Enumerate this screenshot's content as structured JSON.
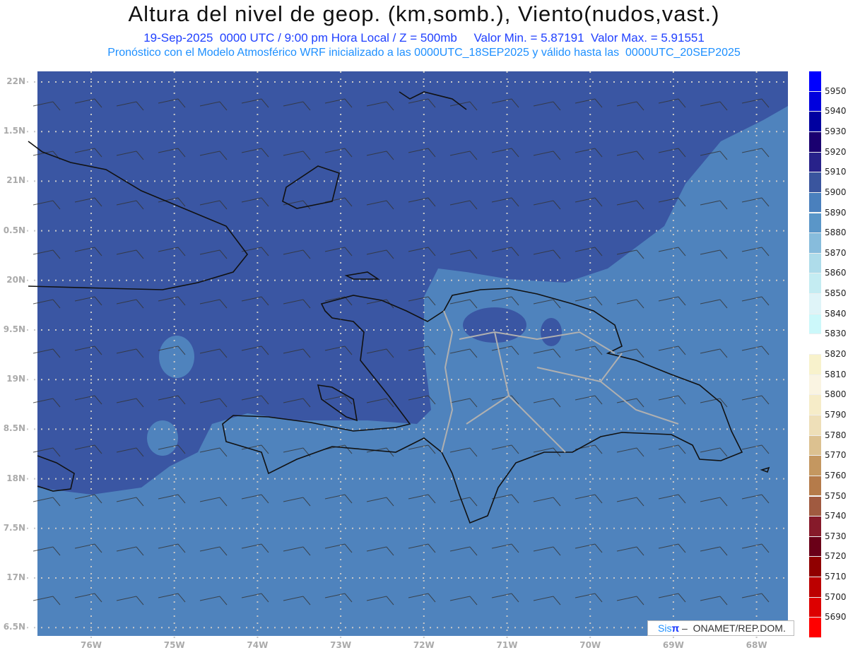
{
  "header": {
    "title": "Altura del nivel de geop. (km,somb.), Viento(nudos,vast.)",
    "subtitle": "19-Sep-2025  0000 UTC / 9:00 pm Hora Local / Z = 500mb     Valor Min. = 5.87191  Valor Max. = 5.91551",
    "model_line": "Pronóstico con el Modelo Atmosférico WRF inicializado a las 0000UTC_18SEP2025 y válido hasta las  0000UTC_20SEP2025"
  },
  "axes": {
    "lat_labels": [
      "22N",
      "1.5N",
      "21N",
      "0.5N",
      "20N",
      "9.5N",
      "19N",
      "8.5N",
      "18N",
      "7.5N",
      "17N",
      "6.5N"
    ],
    "lon_labels": [
      "76W",
      "75W",
      "74W",
      "73W",
      "72W",
      "71W",
      "70W",
      "69W",
      "68W"
    ]
  },
  "colorbar": {
    "labels": [
      "5950",
      "5940",
      "5930",
      "5920",
      "5910",
      "5900",
      "5890",
      "5880",
      "5870",
      "5860",
      "5850",
      "5840",
      "5830",
      "5820",
      "5810",
      "5800",
      "5790",
      "5780",
      "5770",
      "5760",
      "5750",
      "5740",
      "5730",
      "5720",
      "5710",
      "5700",
      "5690"
    ],
    "colors": [
      "#0000ff",
      "#0000dd",
      "#0000a0",
      "#1a0070",
      "#28228a",
      "#3a559e",
      "#4a80bd",
      "#5a96c8",
      "#87bcdc",
      "#aedcea",
      "#c4ecf2",
      "#dff4f8",
      "#ccf8fa",
      "#ffffff",
      "#f8f2cc",
      "#faf4e2",
      "#f6ecc8",
      "#eedfb8",
      "#dcc190",
      "#c49760",
      "#b57b4a",
      "#a05a40",
      "#861a2a",
      "#6a0018",
      "#900000",
      "#bc0000",
      "#dd0000",
      "#ff0000"
    ]
  },
  "fill_colors": {
    "dark": "#3a56a3",
    "light": "#4f83bd"
  },
  "logo": {
    "sis": "Sis",
    "pi": "π",
    "rest": " –  ONAMET/REP.DOM."
  }
}
